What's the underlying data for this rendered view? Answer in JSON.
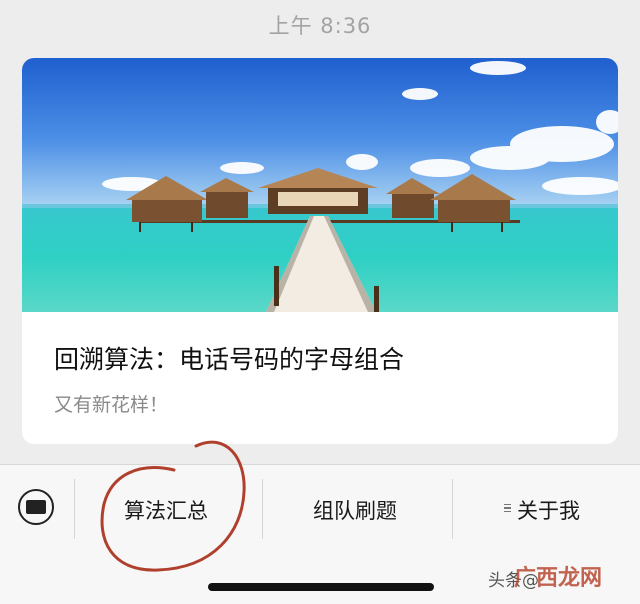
{
  "status": {
    "time": "上午 8:36"
  },
  "article": {
    "title": "回溯算法：电话号码的字母组合",
    "subtitle": "又有新花样！"
  },
  "menu": {
    "items": [
      {
        "label": "算法汇总"
      },
      {
        "label": "组队刷题"
      },
      {
        "label": "关于我"
      }
    ]
  },
  "watermark": {
    "text": "头条@",
    "logo_text": "广西龙网"
  },
  "colors": {
    "annotation": "#b0402e",
    "sky": "#2d6fd6",
    "sea": "#2ec8c8",
    "card": "#ffffff",
    "menu_bg": "#f7f7f7"
  },
  "icons": [
    "keyboard-icon",
    "menu-hamburger-icon"
  ]
}
